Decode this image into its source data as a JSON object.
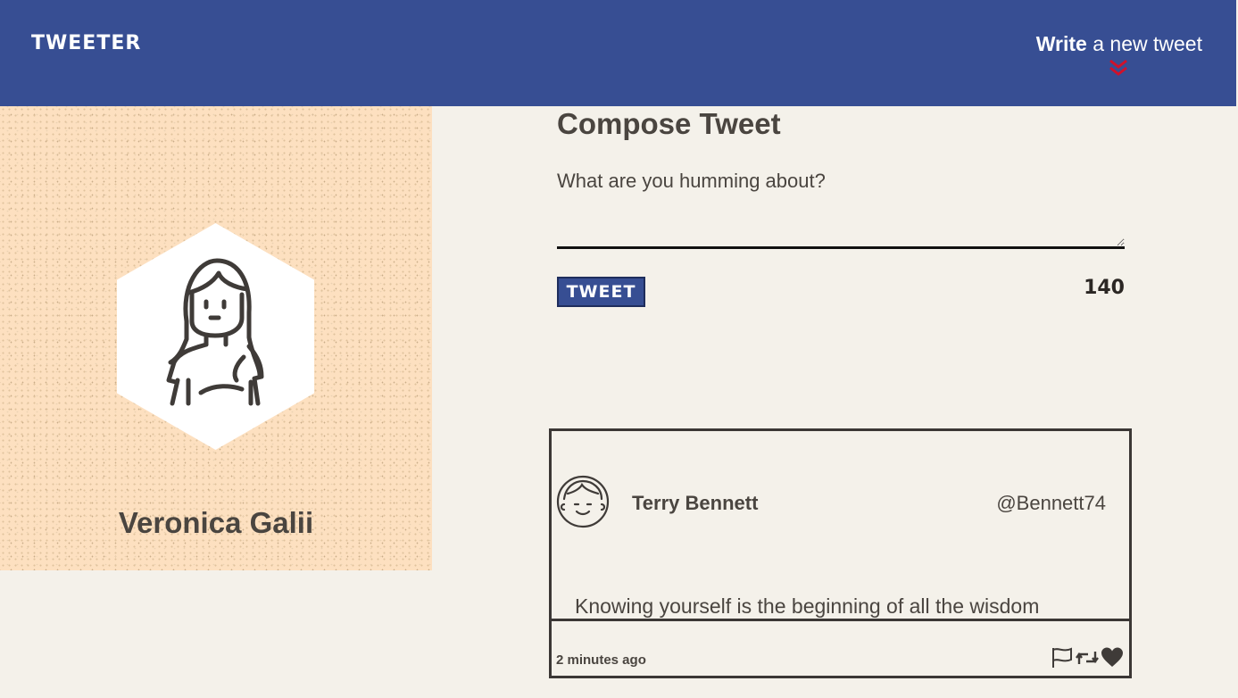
{
  "nav": {
    "brand": "TWEETER",
    "write_bold": "Write",
    "write_rest": " a new tweet",
    "chevron_icon": "double-chevron-down-icon",
    "accent": "#d0112b",
    "bg": "#374e93"
  },
  "profile": {
    "name": "Veronica Galii",
    "avatar_icon": "woman-avatar-icon",
    "bg": "#fde0c0"
  },
  "compose": {
    "title": "Compose Tweet",
    "placeholder": "What are you humming about?",
    "button": "TWEET",
    "counter": "140"
  },
  "tweet": {
    "name": "Terry Bennett",
    "handle": "@Bennett74",
    "text": "Knowing yourself is the beginning of all the wisdom",
    "time": "2 minutes ago",
    "actions": [
      "flag-icon",
      "retweet-icon",
      "heart-icon"
    ]
  }
}
